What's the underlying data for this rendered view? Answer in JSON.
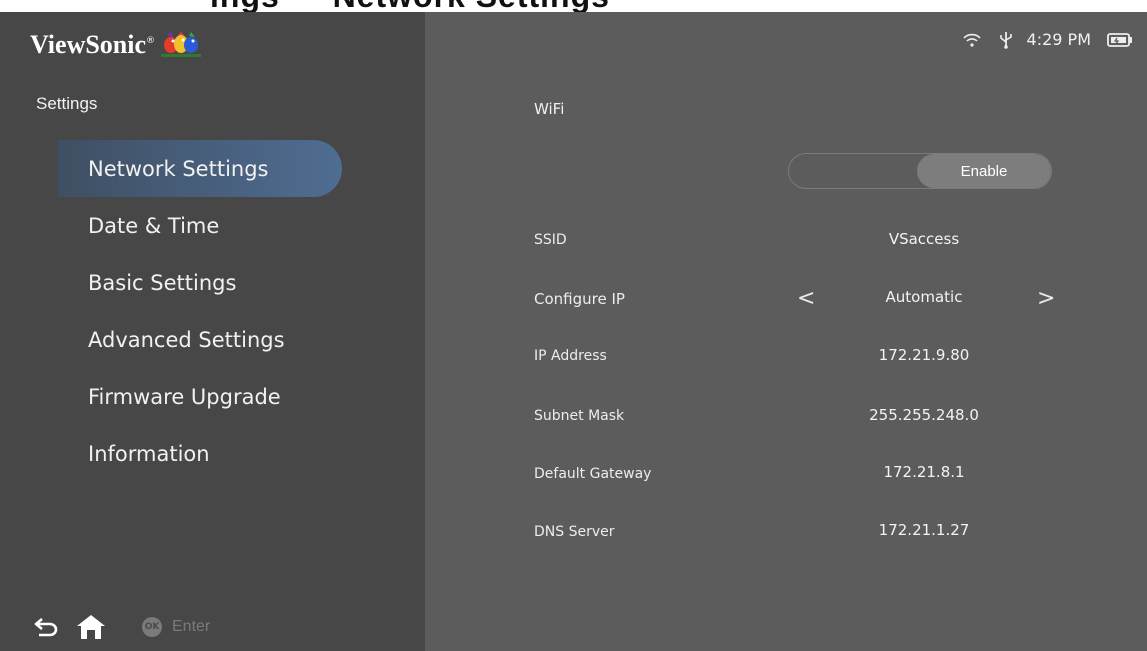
{
  "top_strip_text": "ings — Network Settings",
  "sidebar": {
    "logo_text": "ViewSonic",
    "logo_mark": "®",
    "section_title": "Settings",
    "items": [
      {
        "label": "Network Settings",
        "active": true
      },
      {
        "label": "Date & Time"
      },
      {
        "label": "Basic Settings"
      },
      {
        "label": "Advanced Settings"
      },
      {
        "label": "Firmware Upgrade"
      },
      {
        "label": "Information"
      }
    ],
    "bottom": {
      "ok_badge": "OK",
      "enter_label": "Enter"
    }
  },
  "status_bar": {
    "time": "4:29 PM",
    "icons": [
      "wifi-icon",
      "usb-icon",
      "battery-icon"
    ]
  },
  "wifi": {
    "label": "WiFi",
    "toggle_label": "Enable"
  },
  "fields": [
    {
      "label": "SSID",
      "value": "VSaccess"
    },
    {
      "label": "Configure IP",
      "value": "Automatic"
    },
    {
      "label": "IP Address",
      "value": "172.21.9.80"
    },
    {
      "label": "Subnet Mask",
      "value": "255.255.248.0"
    },
    {
      "label": "Default Gateway",
      "value": "172.21.8.1"
    },
    {
      "label": "DNS Server",
      "value": "172.21.1.27"
    }
  ],
  "colors": {
    "sidebar_bg": "#474747",
    "main_bg": "#5c5c5c",
    "active_item": "#4f6d92"
  }
}
